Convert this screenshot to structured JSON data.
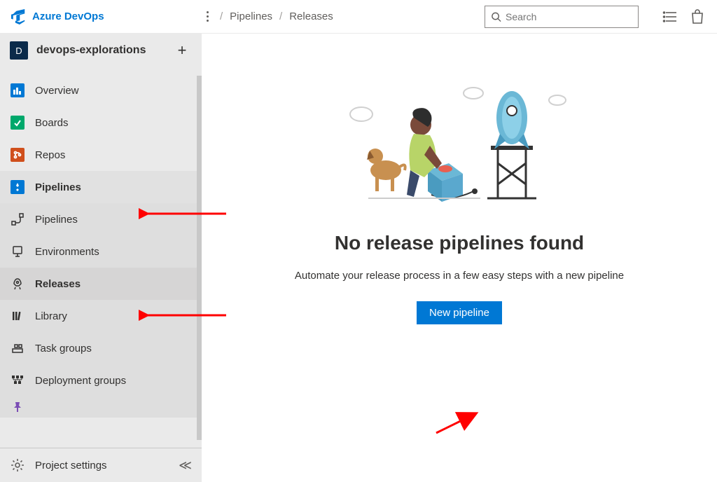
{
  "header": {
    "brand": "Azure DevOps",
    "breadcrumb": [
      "Pipelines",
      "Releases"
    ],
    "search_placeholder": "Search"
  },
  "sidebar": {
    "project_initial": "D",
    "project_name": "devops-explorations",
    "nav": [
      {
        "label": "Overview",
        "icon": "overview-icon"
      },
      {
        "label": "Boards",
        "icon": "boards-icon"
      },
      {
        "label": "Repos",
        "icon": "repos-icon"
      },
      {
        "label": "Pipelines",
        "icon": "pipelines-icon",
        "section": true,
        "bold": true
      },
      {
        "label": "Pipelines",
        "icon": "pipelines-sub-icon",
        "sub": true
      },
      {
        "label": "Environments",
        "icon": "environments-icon",
        "sub": true
      },
      {
        "label": "Releases",
        "icon": "releases-icon",
        "sub": true,
        "bold": true,
        "selected": true
      },
      {
        "label": "Library",
        "icon": "library-icon",
        "sub": true
      },
      {
        "label": "Task groups",
        "icon": "taskgroups-icon",
        "sub": true
      },
      {
        "label": "Deployment groups",
        "icon": "deploymentgroups-icon",
        "sub": true
      }
    ],
    "settings_label": "Project settings"
  },
  "content": {
    "empty_title": "No release pipelines found",
    "empty_subtitle": "Automate your release process in a few easy steps with a new pipeline",
    "new_button": "New pipeline"
  },
  "colors": {
    "primary": "#0078d4"
  }
}
